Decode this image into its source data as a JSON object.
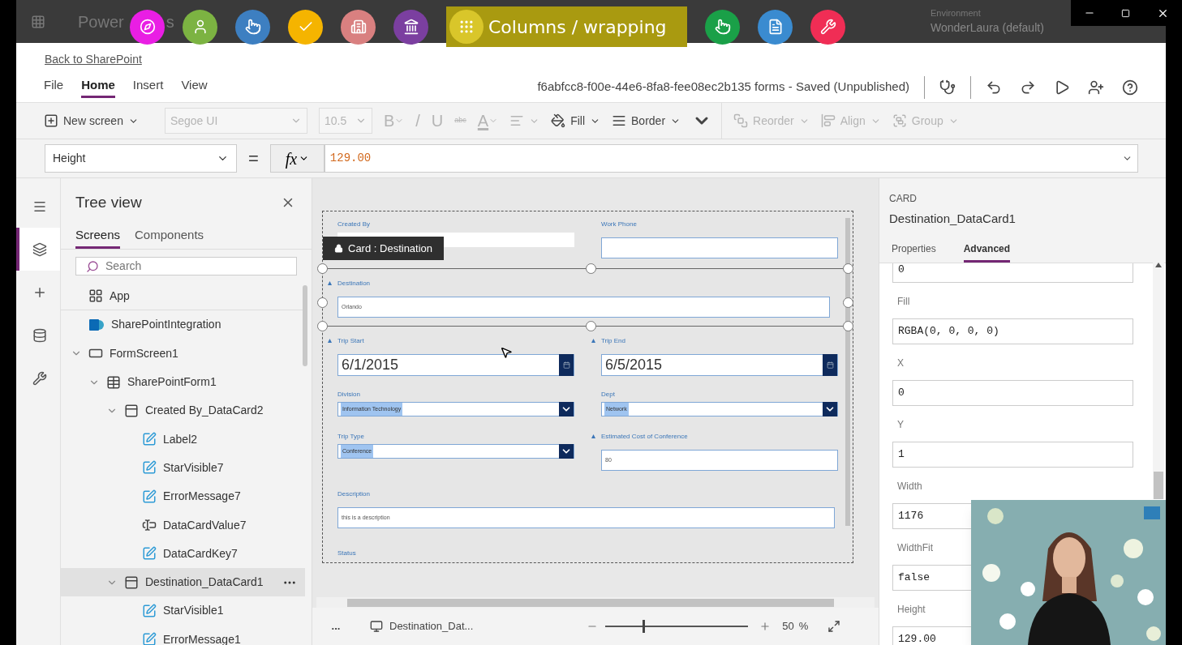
{
  "header": {
    "brand": "Power",
    "brand_tail": "s",
    "environment_label": "Environment",
    "environment": "WonderLaura (default)"
  },
  "overlay_toolbar": [
    {
      "kind": "compass",
      "color": "#e91ee4",
      "selected": false
    },
    {
      "kind": "person",
      "color": "#7cb342",
      "selected": false
    },
    {
      "kind": "pointer",
      "color": "#3d7fc1",
      "selected": false
    },
    {
      "kind": "check",
      "color": "#f5b400",
      "selected": false
    },
    {
      "kind": "building",
      "color": "#d98080",
      "selected": false
    },
    {
      "kind": "landmark",
      "color": "#7b3fa0",
      "selected": false
    },
    {
      "kind": "dots",
      "color": "#d9c62a",
      "selected": true,
      "label": "Columns / wrapping"
    },
    {
      "kind": "pointer",
      "color": "#1aa048",
      "selected": false
    },
    {
      "kind": "document",
      "color": "#3a8bd0",
      "selected": false
    },
    {
      "kind": "tools",
      "color": "#f02d55",
      "selected": false
    }
  ],
  "back_link": "Back to SharePoint",
  "menu": {
    "tabs": [
      {
        "label": "File",
        "selected": false
      },
      {
        "label": "Home",
        "selected": true
      },
      {
        "label": "Insert",
        "selected": false
      },
      {
        "label": "View",
        "selected": false
      }
    ],
    "document_title": "f6abfcc8-f00e-44e6-8fa8-fee08ec2b135 forms - Saved (Unpublished)"
  },
  "toolbar": [
    {
      "kind": "new_screen",
      "label": "New screen",
      "dropdown": true,
      "disabled": false
    },
    {
      "kind": "select",
      "label": "Segoe UI",
      "disabled": true
    },
    {
      "kind": "select",
      "label": "10.5",
      "disabled": true
    },
    {
      "kind": "glyph",
      "label": "B",
      "dropdown": true,
      "disabled": true
    },
    {
      "kind": "glyph",
      "label": "/",
      "dropdown": false,
      "disabled": true
    },
    {
      "kind": "glyph",
      "label": "U",
      "dropdown": false,
      "disabled": true
    },
    {
      "kind": "glyph",
      "label": "abc",
      "dropdown": false,
      "disabled": true
    },
    {
      "kind": "glyph",
      "label": "A",
      "dropdown": true,
      "disabled": true
    },
    {
      "kind": "align_text",
      "dropdown": true,
      "disabled": true
    },
    {
      "kind": "fill",
      "label": "Fill",
      "dropdown": true,
      "disabled": false
    },
    {
      "kind": "border",
      "label": "Border",
      "dropdown": true,
      "disabled": false
    },
    {
      "kind": "more",
      "disabled": false
    },
    {
      "kind": "reorder",
      "label": "Reorder",
      "dropdown": true,
      "disabled": true
    },
    {
      "kind": "align",
      "label": "Align",
      "dropdown": true,
      "disabled": true
    },
    {
      "kind": "group",
      "label": "Group",
      "dropdown": true,
      "disabled": true
    }
  ],
  "formula": {
    "property": "Height",
    "equals": "=",
    "fx": "fx",
    "value": "129.00"
  },
  "rail": [
    {
      "kind": "menu",
      "selected": false
    },
    {
      "kind": "layers",
      "selected": true
    },
    {
      "kind": "insert",
      "selected": false
    },
    {
      "kind": "data",
      "selected": false
    },
    {
      "kind": "tools",
      "selected": false
    }
  ],
  "tree": {
    "title": "Tree view",
    "tabs": [
      {
        "label": "Screens",
        "selected": true
      },
      {
        "label": "Components",
        "selected": false
      }
    ],
    "search_placeholder": "Search",
    "items": [
      {
        "label": "App",
        "kind": "app",
        "selected": false
      },
      {
        "label": "SharePointIntegration",
        "kind": "sharepoint",
        "selected": false
      },
      {
        "label": "FormScreen1",
        "kind": "screen",
        "selected": false,
        "expanded": true,
        "children": [
          {
            "label": "SharePointForm1",
            "kind": "form",
            "selected": false,
            "expanded": true,
            "children": [
              {
                "label": "Created By_DataCard2",
                "kind": "card",
                "selected": false,
                "expanded": true,
                "children": [
                  {
                    "label": "Label2",
                    "kind": "label",
                    "selected": false
                  },
                  {
                    "label": "StarVisible7",
                    "kind": "label",
                    "selected": false
                  },
                  {
                    "label": "ErrorMessage7",
                    "kind": "label",
                    "selected": false
                  },
                  {
                    "label": "DataCardValue7",
                    "kind": "input",
                    "selected": false
                  },
                  {
                    "label": "DataCardKey7",
                    "kind": "label",
                    "selected": false
                  }
                ]
              },
              {
                "label": "Destination_DataCard1",
                "kind": "card",
                "selected": true,
                "expanded": true,
                "children": [
                  {
                    "label": "StarVisible1",
                    "kind": "label",
                    "selected": false
                  },
                  {
                    "label": "ErrorMessage1",
                    "kind": "label",
                    "selected": false
                  }
                ]
              }
            ]
          }
        ]
      }
    ]
  },
  "form": {
    "tooltip": "Card : Destination",
    "rows": [
      [
        {
          "label": "Created By",
          "kind": "readonly",
          "required": false,
          "selected": false
        },
        {
          "label": "Work Phone",
          "kind": "text",
          "required": false,
          "selected": false
        }
      ],
      [
        {
          "label": "Destination",
          "kind": "text",
          "value": "Orlando",
          "required": true,
          "selected": true
        }
      ],
      [
        {
          "label": "Trip Start",
          "kind": "date",
          "value": "6/1/2015",
          "required": true,
          "selected": false
        },
        {
          "label": "Trip End",
          "kind": "date",
          "value": "6/5/2015",
          "required": true,
          "selected": false
        }
      ],
      [
        {
          "label": "Division",
          "kind": "dropdown",
          "value": "Information Technology",
          "required": false,
          "selected": false
        },
        {
          "label": "Dept",
          "kind": "dropdown",
          "value": "Network",
          "required": false,
          "selected": false
        }
      ],
      [
        {
          "label": "Trip Type",
          "kind": "dropdown",
          "value": "Conference",
          "required": false,
          "selected": false
        },
        {
          "label": "Estimated Cost of Conference",
          "kind": "text",
          "value": "80",
          "required": true,
          "selected": false
        }
      ],
      [
        {
          "label": "Description",
          "kind": "text",
          "value": "this is a description",
          "required": false,
          "selected": false
        }
      ],
      [
        {
          "label": "Status",
          "kind": "label_only",
          "required": false,
          "selected": false
        }
      ]
    ]
  },
  "status_bar": {
    "more": "...",
    "screen": "Destination_Dat...",
    "zoom": {
      "level": 0.26
    },
    "zoom_value": "50",
    "zoom_unit": "%"
  },
  "panel": {
    "type": "CARD",
    "name": "Destination_DataCard1",
    "tabs": [
      {
        "label": "Properties",
        "selected": false
      },
      {
        "label": "Advanced",
        "selected": true
      }
    ],
    "properties": [
      {
        "value": "0"
      },
      {
        "label": "Fill",
        "value": "RGBA(0, 0, 0, 0)"
      },
      {
        "label": "X",
        "value": "0"
      },
      {
        "label": "Y",
        "value": "1"
      },
      {
        "label": "Width",
        "value": "1176"
      },
      {
        "label": "WidthFit",
        "value": "false"
      },
      {
        "label": "Height",
        "value": "129.00"
      }
    ]
  }
}
